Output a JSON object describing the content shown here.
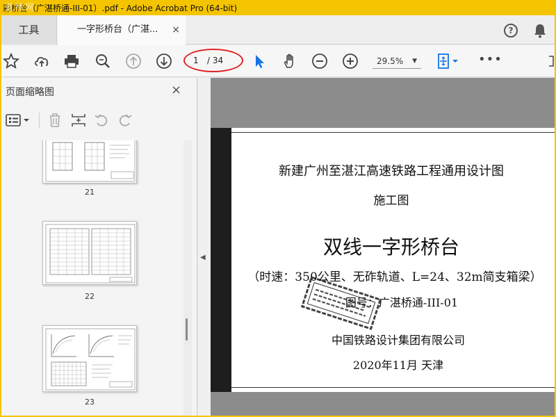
{
  "window": {
    "title": "彩桥台（广湛桥通-III-01）.pdf - Adobe Acrobat Pro (64-bit)",
    "watermark": "道林网"
  },
  "tabs": {
    "tools": "工具",
    "document": "一字形桥台（广湛...",
    "close": "×"
  },
  "toolbar": {
    "page_current": "1",
    "page_total": "/ 34",
    "zoom": "29.5%",
    "more": "•••"
  },
  "sidebar": {
    "title": "页面缩略图",
    "close": "×",
    "thumbnails": [
      {
        "label": "21"
      },
      {
        "label": "22"
      },
      {
        "label": "23"
      }
    ]
  },
  "document": {
    "line1": "新建广州至湛江高速铁路工程通用设计图",
    "line2": "施工图",
    "title": "双线一字形桥台",
    "subtitle": "（时速：350公里、无砟轨道、L=24、32m简支箱梁）",
    "drawing_no": "图号：广湛桥通-III-01",
    "company": "中国铁路设计集团有限公司",
    "date_place": "2020年11月  天津"
  },
  "colors": {
    "window_frame": "#f5c400",
    "annotation_ellipse": "#e02020",
    "select_tool_blue": "#1473e6"
  }
}
